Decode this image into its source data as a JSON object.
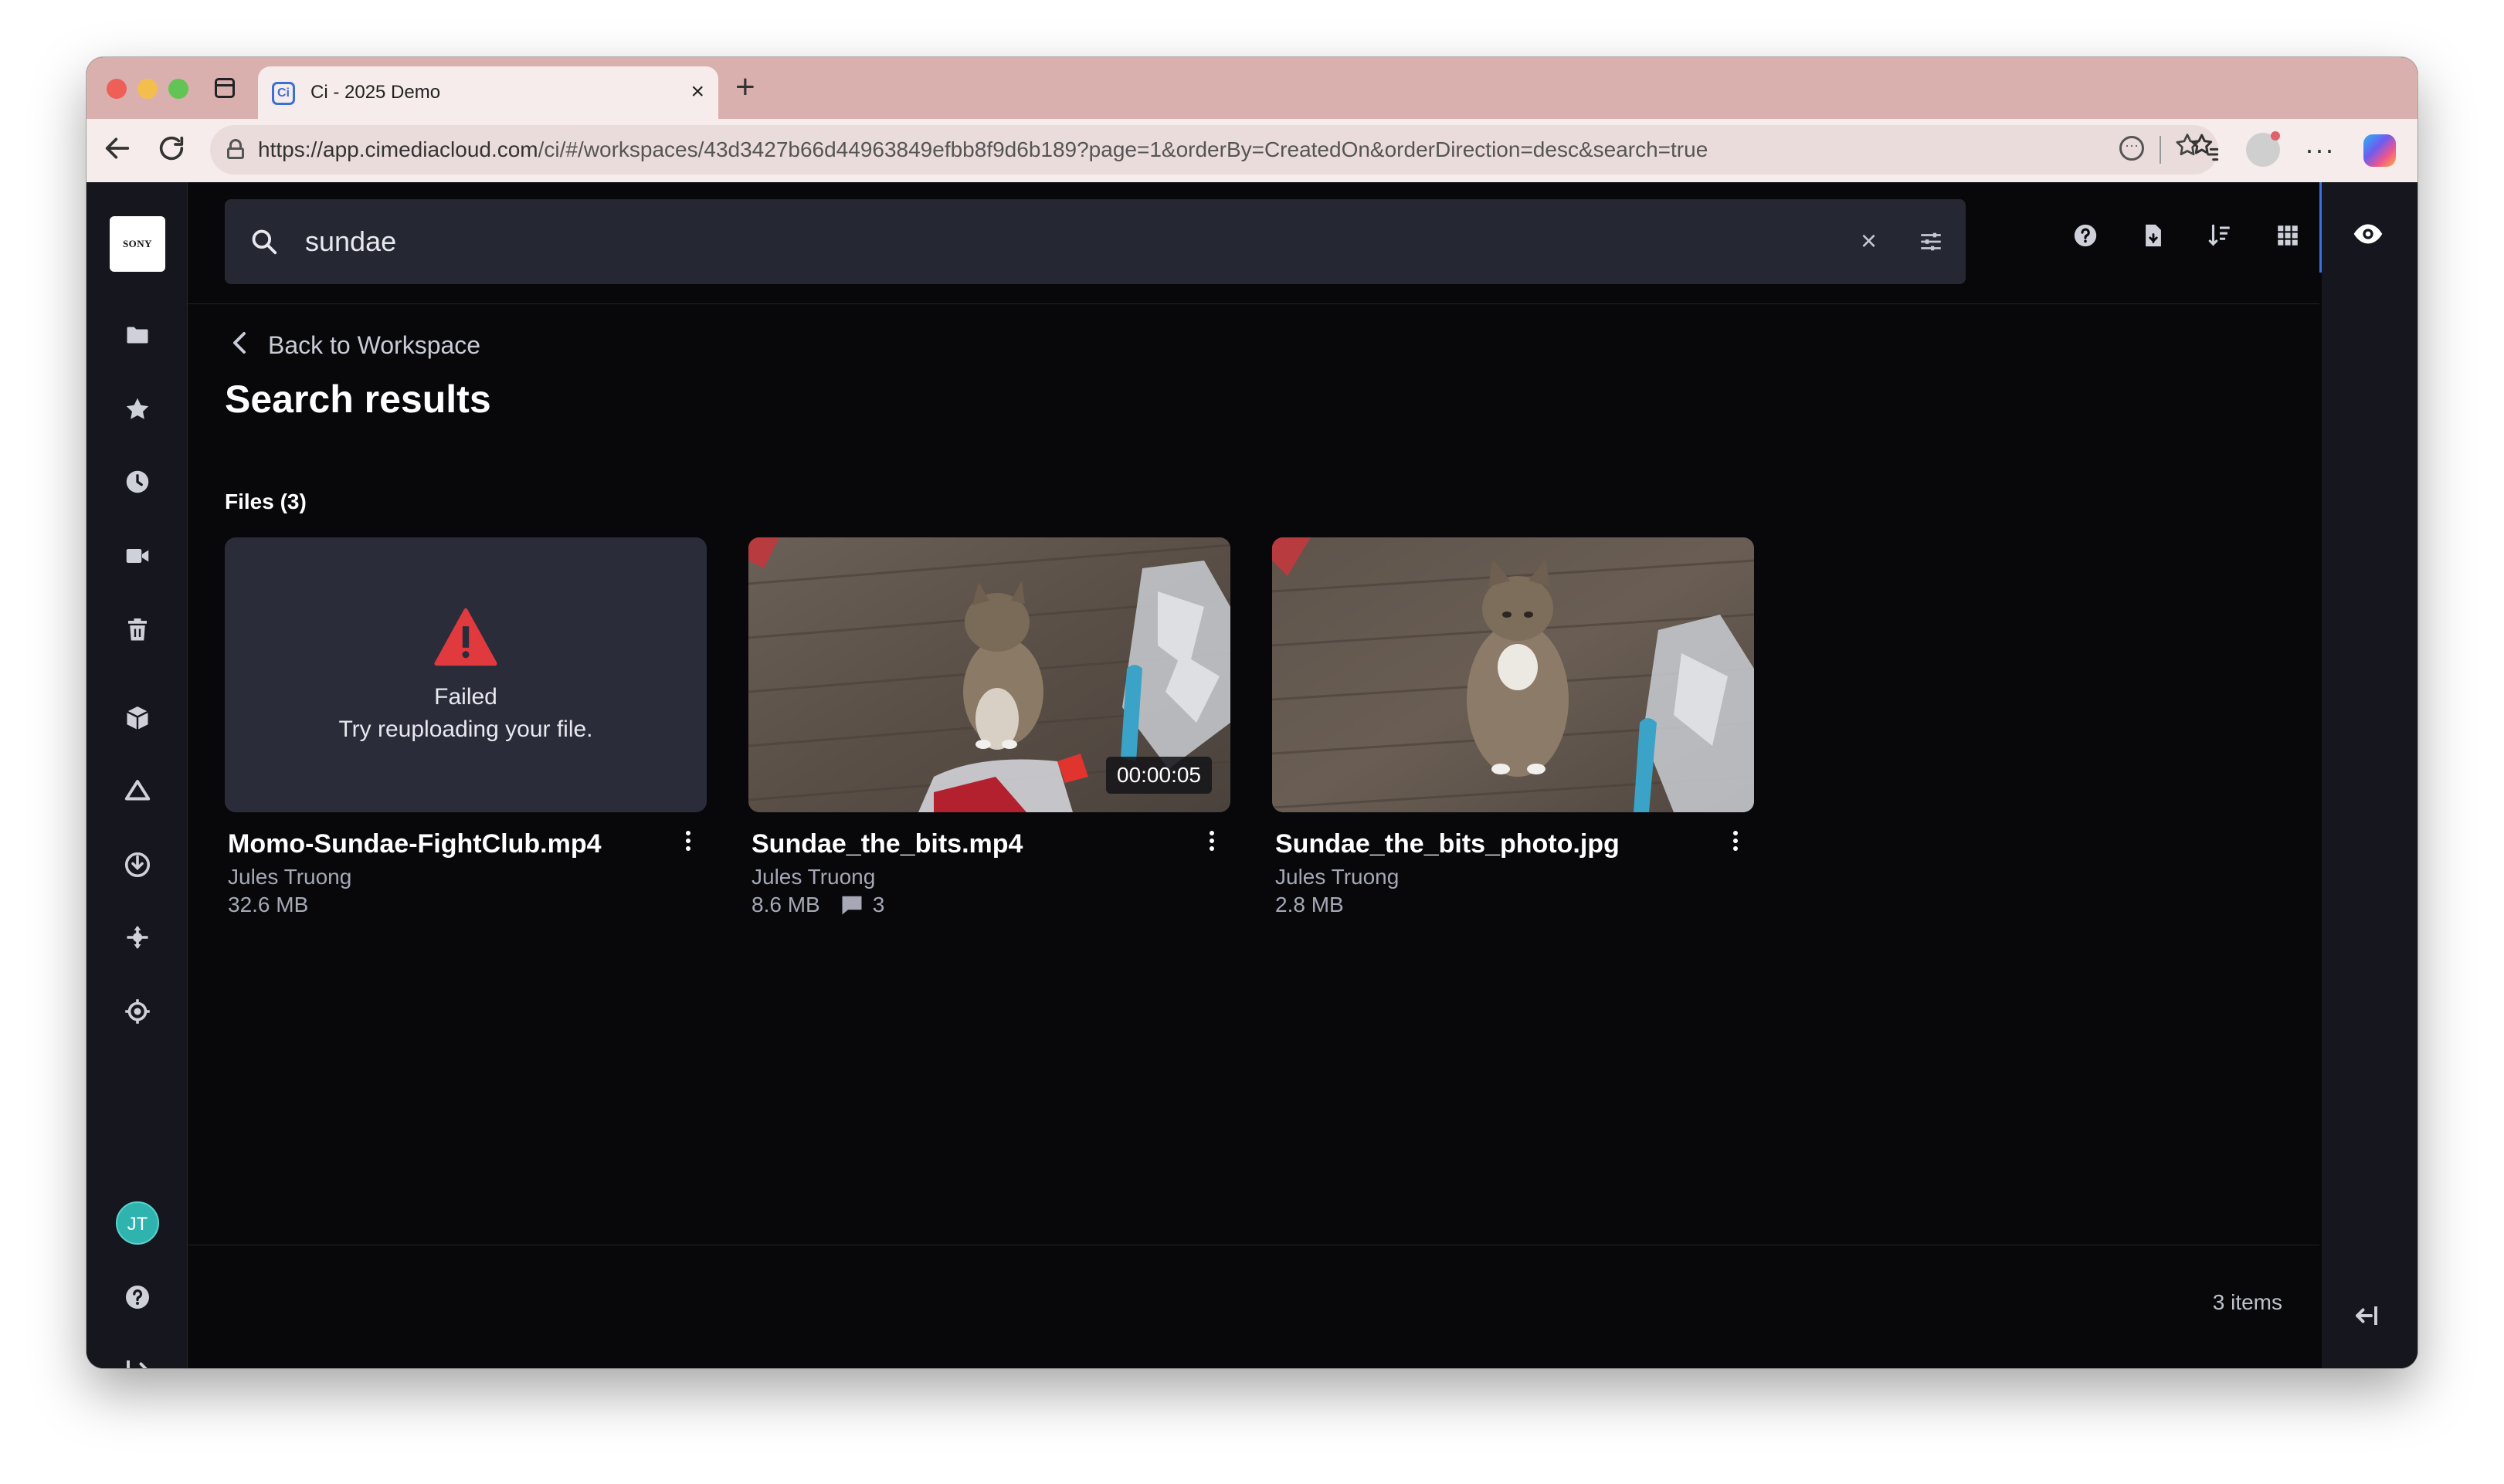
{
  "browser": {
    "tab_title": "Ci - 2025 Demo",
    "tab_favicon": "Ci",
    "tab_close": "×",
    "new_tab": "+",
    "url_domain": "https://app.cimediacloud.com",
    "url_path": "/ci/#/workspaces/43d3427b66d44963849efbb8f9d6b189?page=1&orderBy=CreatedOn&orderDirection=desc&search=true"
  },
  "app": {
    "logo_text": "SONY",
    "avatar_initials": "JT",
    "nav_icons": [
      "folder-icon",
      "star-icon",
      "clock-icon",
      "video-icon",
      "trash-icon",
      "box-icon",
      "cloud-icon",
      "download-icon",
      "integration-icon",
      "target-icon"
    ]
  },
  "search": {
    "value": "sundae",
    "clear": "×"
  },
  "content": {
    "back_label": "Back to Workspace",
    "page_title": "Search results",
    "section_label": "Files (3)"
  },
  "files": [
    {
      "name": "Momo-Sundae-FightClub.mp4",
      "owner": "Jules Truong",
      "size": "32.6 MB",
      "status": "Failed",
      "status_detail": "Try reuploading your file."
    },
    {
      "name": "Sundae_the_bits.mp4",
      "owner": "Jules Truong",
      "size": "8.6 MB",
      "comments": "3",
      "duration": "00:00:05"
    },
    {
      "name": "Sundae_the_bits_photo.jpg",
      "owner": "Jules Truong",
      "size": "2.8 MB"
    }
  ],
  "footer": {
    "item_count": "3 items"
  },
  "colors": {
    "accent": "#3a6fe8",
    "warning": "#e0393e",
    "avatar": "#2fb3ae",
    "background": "#08080b"
  }
}
